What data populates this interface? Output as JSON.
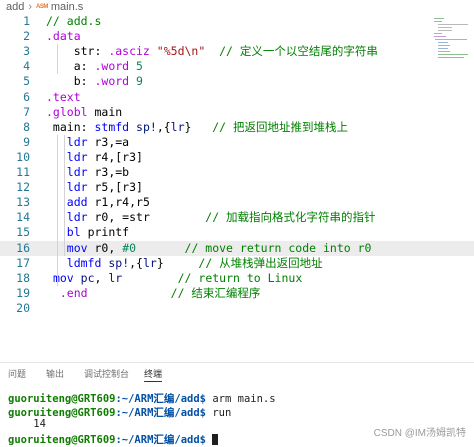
{
  "breadcrumb": {
    "folder": "add",
    "file": "main.s",
    "file_icon": "ASM"
  },
  "code_lines": [
    {
      "num": "1",
      "parts": [
        [
          "c-cmt",
          "// add.s"
        ]
      ]
    },
    {
      "num": "2",
      "parts": [
        [
          "c-dir",
          ".data"
        ]
      ]
    },
    {
      "num": "3",
      "parts": [
        [
          "c-plain",
          "    str: "
        ],
        [
          "c-dir",
          ".asciz"
        ],
        [
          "c-plain",
          " "
        ],
        [
          "c-str",
          "\"%5d\\n\""
        ],
        [
          "c-plain",
          "  "
        ],
        [
          "c-cmt",
          "// 定义一个以空结尾的字符串"
        ]
      ]
    },
    {
      "num": "4",
      "parts": [
        [
          "c-plain",
          "    a: "
        ],
        [
          "c-dir",
          ".word"
        ],
        [
          "c-plain",
          " "
        ],
        [
          "c-num",
          "5"
        ]
      ]
    },
    {
      "num": "5",
      "parts": [
        [
          "c-plain",
          "    b: "
        ],
        [
          "c-dir",
          ".word"
        ],
        [
          "c-plain",
          " "
        ],
        [
          "c-num",
          "9"
        ]
      ]
    },
    {
      "num": "6",
      "parts": [
        [
          "c-dir",
          ".text"
        ]
      ]
    },
    {
      "num": "7",
      "parts": [
        [
          "c-dir",
          ".globl"
        ],
        [
          "c-plain",
          " main"
        ]
      ]
    },
    {
      "num": "8",
      "parts": [
        [
          "c-plain",
          " main: "
        ],
        [
          "c-kw",
          "stmfd"
        ],
        [
          "c-plain",
          " "
        ],
        [
          "c-id",
          "sp!"
        ],
        [
          "c-plain",
          ",{"
        ],
        [
          "c-id",
          "lr"
        ],
        [
          "c-plain",
          "}   "
        ],
        [
          "c-cmt",
          "// 把返回地址推到堆栈上"
        ]
      ]
    },
    {
      "num": "9",
      "parts": [
        [
          "c-plain",
          "   "
        ],
        [
          "c-kw",
          "ldr"
        ],
        [
          "c-plain",
          " r3,=a"
        ]
      ]
    },
    {
      "num": "10",
      "parts": [
        [
          "c-plain",
          "   "
        ],
        [
          "c-kw",
          "ldr"
        ],
        [
          "c-plain",
          " r4,[r3]"
        ]
      ]
    },
    {
      "num": "11",
      "parts": [
        [
          "c-plain",
          "   "
        ],
        [
          "c-kw",
          "ldr"
        ],
        [
          "c-plain",
          " r3,=b"
        ]
      ]
    },
    {
      "num": "12",
      "parts": [
        [
          "c-plain",
          "   "
        ],
        [
          "c-kw",
          "ldr"
        ],
        [
          "c-plain",
          " r5,[r3]"
        ]
      ]
    },
    {
      "num": "13",
      "parts": [
        [
          "c-plain",
          "   "
        ],
        [
          "c-kw",
          "add"
        ],
        [
          "c-plain",
          " r1,r4,r5"
        ]
      ]
    },
    {
      "num": "14",
      "parts": [
        [
          "c-plain",
          "   "
        ],
        [
          "c-kw",
          "ldr"
        ],
        [
          "c-plain",
          " r0, =str        "
        ],
        [
          "c-cmt",
          "// 加载指向格式化字符串的指针"
        ]
      ]
    },
    {
      "num": "15",
      "parts": [
        [
          "c-plain",
          "   "
        ],
        [
          "c-kw",
          "bl"
        ],
        [
          "c-plain",
          " printf"
        ]
      ]
    },
    {
      "num": "16",
      "parts": [
        [
          "c-plain",
          "   "
        ],
        [
          "c-kw",
          "mov"
        ],
        [
          "c-plain",
          " r0, "
        ],
        [
          "c-num",
          "#0"
        ],
        [
          "c-plain",
          "       "
        ],
        [
          "c-cmt",
          "// move return code into r0"
        ]
      ],
      "highlight": true
    },
    {
      "num": "17",
      "parts": [
        [
          "c-plain",
          "   "
        ],
        [
          "c-kw",
          "ldmfd"
        ],
        [
          "c-plain",
          " "
        ],
        [
          "c-id",
          "sp!"
        ],
        [
          "c-plain",
          ",{"
        ],
        [
          "c-id",
          "lr"
        ],
        [
          "c-plain",
          "}     "
        ],
        [
          "c-cmt",
          "// 从堆栈弹出返回地址"
        ]
      ]
    },
    {
      "num": "18",
      "parts": [
        [
          "c-plain",
          " "
        ],
        [
          "c-kw",
          "mov"
        ],
        [
          "c-plain",
          " "
        ],
        [
          "c-id",
          "pc"
        ],
        [
          "c-plain",
          ", "
        ],
        [
          "c-id",
          "lr"
        ],
        [
          "c-plain",
          "        "
        ],
        [
          "c-cmt",
          "// return to Linux"
        ]
      ]
    },
    {
      "num": "19",
      "parts": [
        [
          "c-plain",
          "  "
        ],
        [
          "c-dir",
          ".end"
        ],
        [
          "c-plain",
          "            "
        ],
        [
          "c-cmt",
          "// 结束汇编程序"
        ]
      ]
    },
    {
      "num": "20",
      "parts": []
    }
  ],
  "panel": {
    "tabs": [
      "问题",
      "输出",
      "调试控制台",
      "终端"
    ],
    "active_tab": 3
  },
  "terminal": {
    "lines": [
      {
        "user": "guoruiteng@GRT609",
        "path": ":~/ARM汇编/add$",
        "cmd": " arm main.s"
      },
      {
        "user": "guoruiteng@GRT609",
        "path": ":~/ARM汇编/add$",
        "cmd": " run"
      },
      {
        "output": "    14"
      },
      {
        "user": "guoruiteng@GRT609",
        "path": ":~/ARM汇编/add$",
        "cmd": " ",
        "cursor": true
      }
    ]
  },
  "watermark": "CSDN @IM汤姆凯特",
  "colors": {
    "line_number": "#237893",
    "comment": "#008000",
    "keyword": "#0000ff",
    "directive": "#af00db",
    "number": "#098658",
    "string": "#a31515",
    "prompt_user": "#0f7d00",
    "prompt_path": "#0451a5"
  }
}
